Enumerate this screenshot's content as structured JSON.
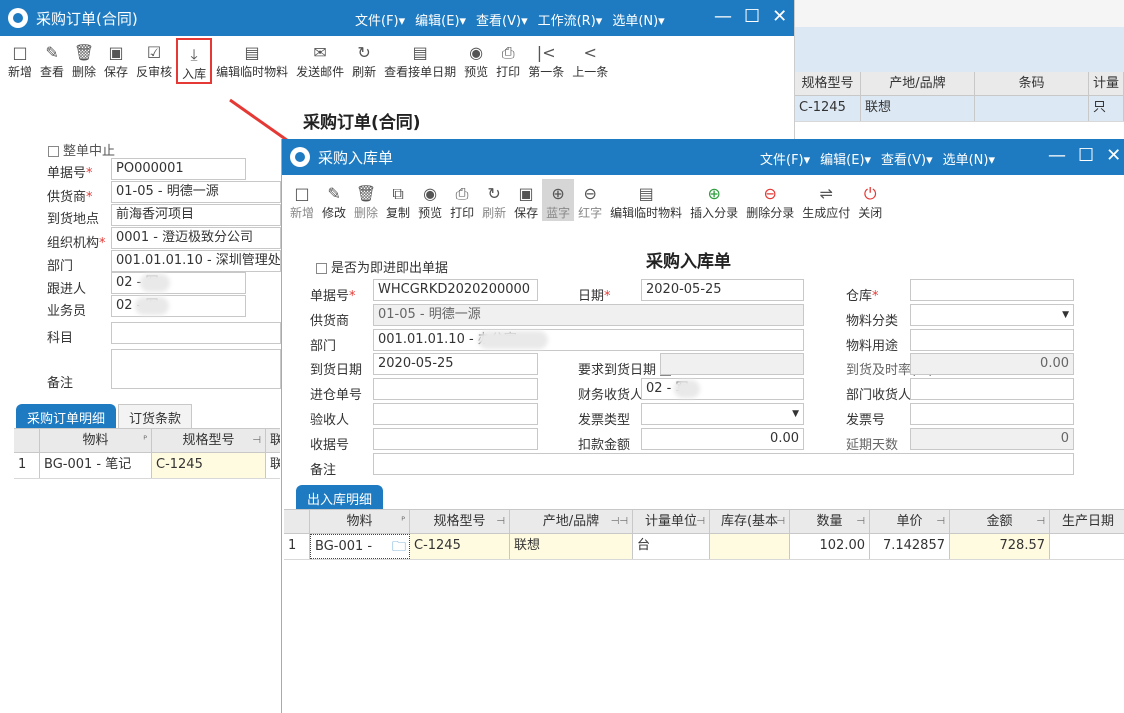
{
  "po": {
    "title": "采购订单(合同)",
    "menu": [
      "文件(F)▾",
      "编辑(E)▾",
      "查看(V)▾",
      "工作流(R)▾",
      "选单(N)▾"
    ],
    "toolbar": [
      {
        "icon": "□",
        "label": "新增"
      },
      {
        "icon": "✎",
        "label": "查看"
      },
      {
        "icon": "🗑",
        "label": "删除"
      },
      {
        "icon": "▣",
        "label": "保存"
      },
      {
        "icon": "☑",
        "label": "反审核"
      },
      {
        "icon": "⤓",
        "label": "入库"
      },
      {
        "icon": "▤",
        "label": "编辑临时物料"
      },
      {
        "icon": "✉",
        "label": "发送邮件"
      },
      {
        "icon": "↻",
        "label": "刷新"
      },
      {
        "icon": "▤",
        "label": "查看接单日期"
      },
      {
        "icon": "◉",
        "label": "预览"
      },
      {
        "icon": "⎙",
        "label": "打印"
      },
      {
        "icon": "|<",
        "label": "第一条"
      },
      {
        "icon": "<",
        "label": "上一条"
      }
    ],
    "more": "»",
    "doc_title": "采购订单(合同)",
    "close_order_label": "整单中止",
    "fields": {
      "order_no_label": "单据号",
      "order_no": "PO000001",
      "supplier_label": "供货商",
      "supplier": "01-05 - 明德一源",
      "location_label": "到货地点",
      "location": "前海香河项目",
      "org_label": "组织机构",
      "org": "0001 - 澄迈极致分公司",
      "dept_label": "部门",
      "dept": "001.01.01.10 - 深圳管理处",
      "follower_label": "跟进人",
      "follower": "02 - 军",
      "clerk_label": "业务员",
      "clerk": "02 - 军",
      "subject_label": "科目",
      "subject": "",
      "remark_label": "备注",
      "remark": ""
    },
    "tabs": [
      "采购订单明细",
      "订货条款"
    ],
    "grid": {
      "headers": [
        "物料",
        "规格型号",
        "联"
      ],
      "row": {
        "no": "1",
        "material": "BG-001 - 笔记",
        "spec": "C-1245",
        "brand": "联"
      }
    },
    "right_grid": {
      "headers": [
        "规格型号",
        "产地/品牌",
        "条码",
        "计量"
      ],
      "row": {
        "spec": "C-1245",
        "brand": "联想",
        "barcode": "",
        "unit": "只"
      }
    }
  },
  "inbound": {
    "title": "采购入库单",
    "menu": [
      "文件(F)▾",
      "编辑(E)▾",
      "查看(V)▾",
      "选单(N)▾"
    ],
    "toolbar": [
      {
        "icon": "□",
        "label": "新增"
      },
      {
        "icon": "✎",
        "label": "修改"
      },
      {
        "icon": "🗑",
        "label": "删除"
      },
      {
        "icon": "⧉",
        "label": "复制"
      },
      {
        "icon": "◉",
        "label": "预览"
      },
      {
        "icon": "⎙",
        "label": "打印"
      },
      {
        "icon": "↻",
        "label": "刷新"
      },
      {
        "icon": "▣",
        "label": "保存"
      },
      {
        "icon": "⊕",
        "label": "蓝字"
      },
      {
        "icon": "⊖",
        "label": "红字"
      },
      {
        "icon": "▤",
        "label": "编辑临时物料"
      },
      {
        "icon": "⊕",
        "label": "插入分录"
      },
      {
        "icon": "⊖",
        "label": "删除分录"
      },
      {
        "icon": "⇌",
        "label": "生成应付"
      },
      {
        "icon": "⏻",
        "label": "关闭"
      }
    ],
    "doc_title": "采购入库单",
    "instant_label": "是否为即进即出单据",
    "fields": {
      "bill_no_label": "单据号",
      "bill_no": "WHCGRKD2020200000",
      "date_label": "日期",
      "date": "2020-05-25",
      "warehouse_label": "仓库",
      "warehouse": "",
      "supplier_label": "供货商",
      "supplier": "01-05 - 明德一源",
      "category_label": "物料分类",
      "category": "",
      "dept_label": "部门",
      "dept": "001.01.01.10 - 办公室",
      "usage_label": "物料用途",
      "usage": "",
      "arrival_label": "到货日期",
      "arrival": "2020-05-25",
      "require_label": "要求到货日期",
      "rate_label": "到货及时率(%)",
      "rate": "0.00",
      "entry_label": "进仓单号",
      "entry": "",
      "payee_label": "财务收货人",
      "payee": "02 - 军",
      "dept_payee_label": "部门收货人",
      "dept_payee": "",
      "inspector_label": "验收人",
      "inspector": "",
      "invoice_type_label": "发票类型",
      "invoice_type": "",
      "invoice_no_label": "发票号",
      "invoice_no": "",
      "receipt_label": "收据号",
      "receipt": "",
      "deduct_label": "扣款金额",
      "deduct": "0.00",
      "delay_label": "延期天数",
      "delay": "0",
      "remark_label": "备注",
      "remark": ""
    },
    "tab": "出入库明细",
    "grid": {
      "headers": [
        "物料",
        "规格型号",
        "产地/品牌",
        "计量单位",
        "库存(基本",
        "数量",
        "单价",
        "金额",
        "生产日期"
      ],
      "row": {
        "no": "1",
        "material": "BG-001 -",
        "spec": "C-1245",
        "brand": "联想",
        "unit": "台",
        "stock": "",
        "qty": "102.00",
        "price": "7.142857",
        "amount": "728.57",
        "mfg": ""
      }
    }
  },
  "colors": {
    "titlebar": "#1f7bc1",
    "arrow": "#e53935",
    "highlight": "#e53935"
  }
}
